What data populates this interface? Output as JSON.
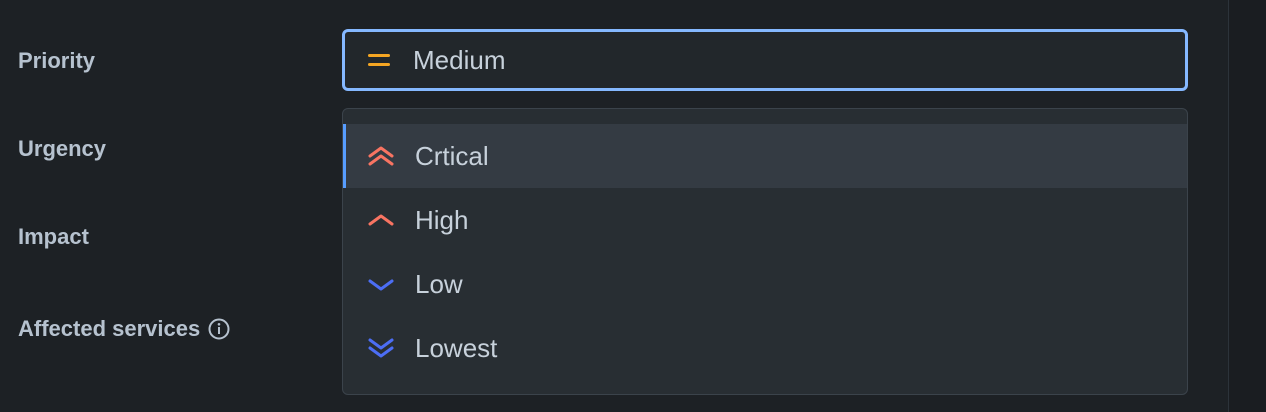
{
  "form": {
    "labels": {
      "priority": "Priority",
      "urgency": "Urgency",
      "impact": "Impact",
      "affected_services": "Affected services"
    },
    "priority_select": {
      "value": "Medium",
      "icon": "medium-priority-icon"
    },
    "dropdown": {
      "options": [
        {
          "label": "Crtical",
          "icon": "critical-priority-icon",
          "highlighted": true
        },
        {
          "label": "High",
          "icon": "high-priority-icon",
          "highlighted": false
        },
        {
          "label": "Low",
          "icon": "low-priority-icon",
          "highlighted": false
        },
        {
          "label": "Lowest",
          "icon": "lowest-priority-icon",
          "highlighted": false
        }
      ]
    }
  },
  "colors": {
    "background": "#1d2125",
    "focus_border": "#85b8ff",
    "medium": "#f5a623",
    "high": "#f87462",
    "low": "#4c6ef5",
    "highlight_bar": "#579dff"
  }
}
